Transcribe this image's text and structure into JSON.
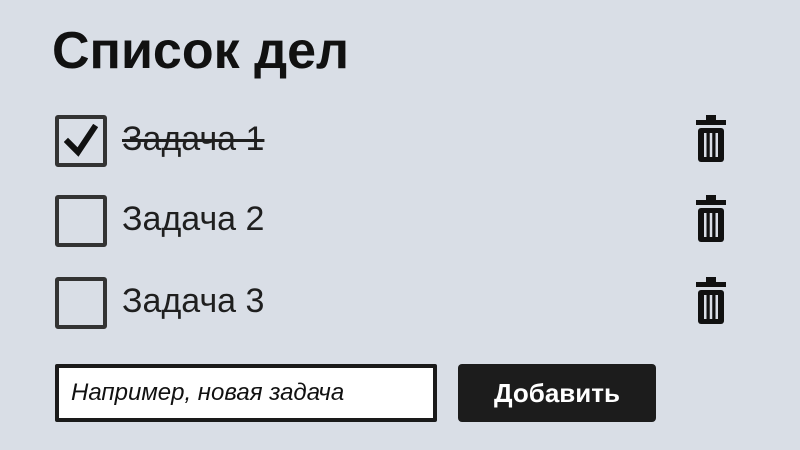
{
  "app": {
    "title": "Список дел"
  },
  "tasks": [
    {
      "label": "Задача 1",
      "completed": true
    },
    {
      "label": "Задача 2",
      "completed": false
    },
    {
      "label": "Задача 3",
      "completed": false
    }
  ],
  "new_task": {
    "value": "",
    "placeholder": "Например, новая задача"
  },
  "add_button": {
    "label": "Добавить"
  },
  "icons": {
    "checkbox_checked": "check-icon",
    "delete": "trash-icon"
  },
  "colors": {
    "background": "#d9dee6",
    "text": "#1f1f1f",
    "button_background": "#1c1c1c",
    "button_text": "#ffffff"
  }
}
